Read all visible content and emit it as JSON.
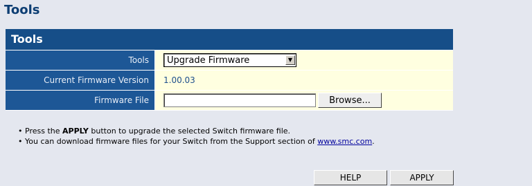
{
  "page": {
    "title": "Tools"
  },
  "panel": {
    "header": "Tools",
    "rows": {
      "tools": {
        "label": "Tools",
        "selected": "Upgrade Firmware",
        "icon": "chevron-down-icon"
      },
      "firmware_version": {
        "label": "Current Firmware Version",
        "value": "1.00.03"
      },
      "firmware_file": {
        "label": "Firmware File",
        "value": "",
        "browse_label": "Browse..."
      }
    }
  },
  "notes": {
    "note1_pre": "Press the ",
    "note1_bold": "APPLY",
    "note1_post": " button to upgrade the selected Switch firmware file.",
    "note2_pre": "You can download firmware files for your Switch from the Support section of ",
    "note2_link": "www.smc.com",
    "note2_post": "."
  },
  "buttons": {
    "help": "HELP",
    "apply": "APPLY"
  },
  "colors": {
    "page_bg": "#e4e7ef",
    "title": "#0d3e73",
    "header_bg": "#164e88",
    "label_bg": "#1d5796",
    "value_bg": "#ffffe0",
    "link": "#00009c"
  }
}
